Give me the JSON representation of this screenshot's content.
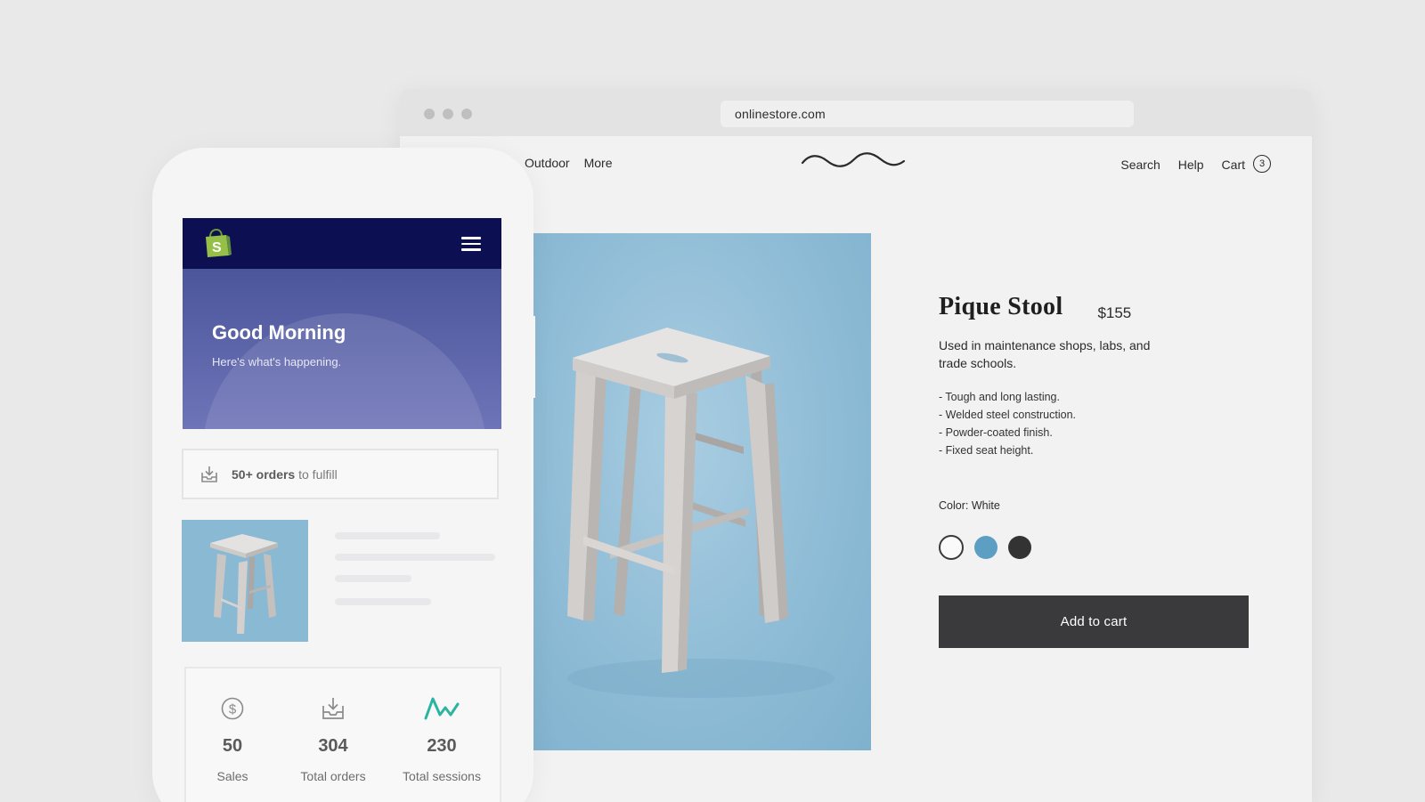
{
  "browser": {
    "url": "onlinestore.com"
  },
  "store": {
    "nav_left": [
      "Outdoor",
      "More"
    ],
    "nav_search": "Search",
    "nav_help": "Help",
    "nav_cart": "Cart",
    "cart_count": "3"
  },
  "product": {
    "title": "Pique Stool",
    "price": "$155",
    "description": "Used in maintenance shops, labs, and trade schools.",
    "features": [
      "- Tough and long lasting.",
      "- Welded steel construction.",
      "- Powder-coated finish.",
      "- Fixed seat height."
    ],
    "color_label": "Color: White",
    "swatches": [
      {
        "name": "white",
        "color": "#fafafa"
      },
      {
        "name": "blue",
        "color": "#5d9ec3"
      },
      {
        "name": "black",
        "color": "#333333"
      }
    ],
    "add_to_cart": "Add to cart"
  },
  "admin_app": {
    "greeting": "Good Morning",
    "subtitle": "Here's what's happening.",
    "orders_count": "50+ orders",
    "orders_rest": "to fulfill",
    "stats": [
      {
        "icon": "dollar-icon",
        "value": "50",
        "label": "Sales"
      },
      {
        "icon": "tray-download-icon",
        "value": "304",
        "label": "Total orders"
      },
      {
        "icon": "activity-icon",
        "value": "230",
        "label": "Total sessions"
      }
    ]
  },
  "colors": {
    "app_header": "#0c0f52",
    "hero": "#5a62a8",
    "product_bg": "#8fbcd6",
    "button": "#3a3a3c",
    "activity_accent": "#2bb5a0",
    "shopify_green": "#95bf47"
  }
}
